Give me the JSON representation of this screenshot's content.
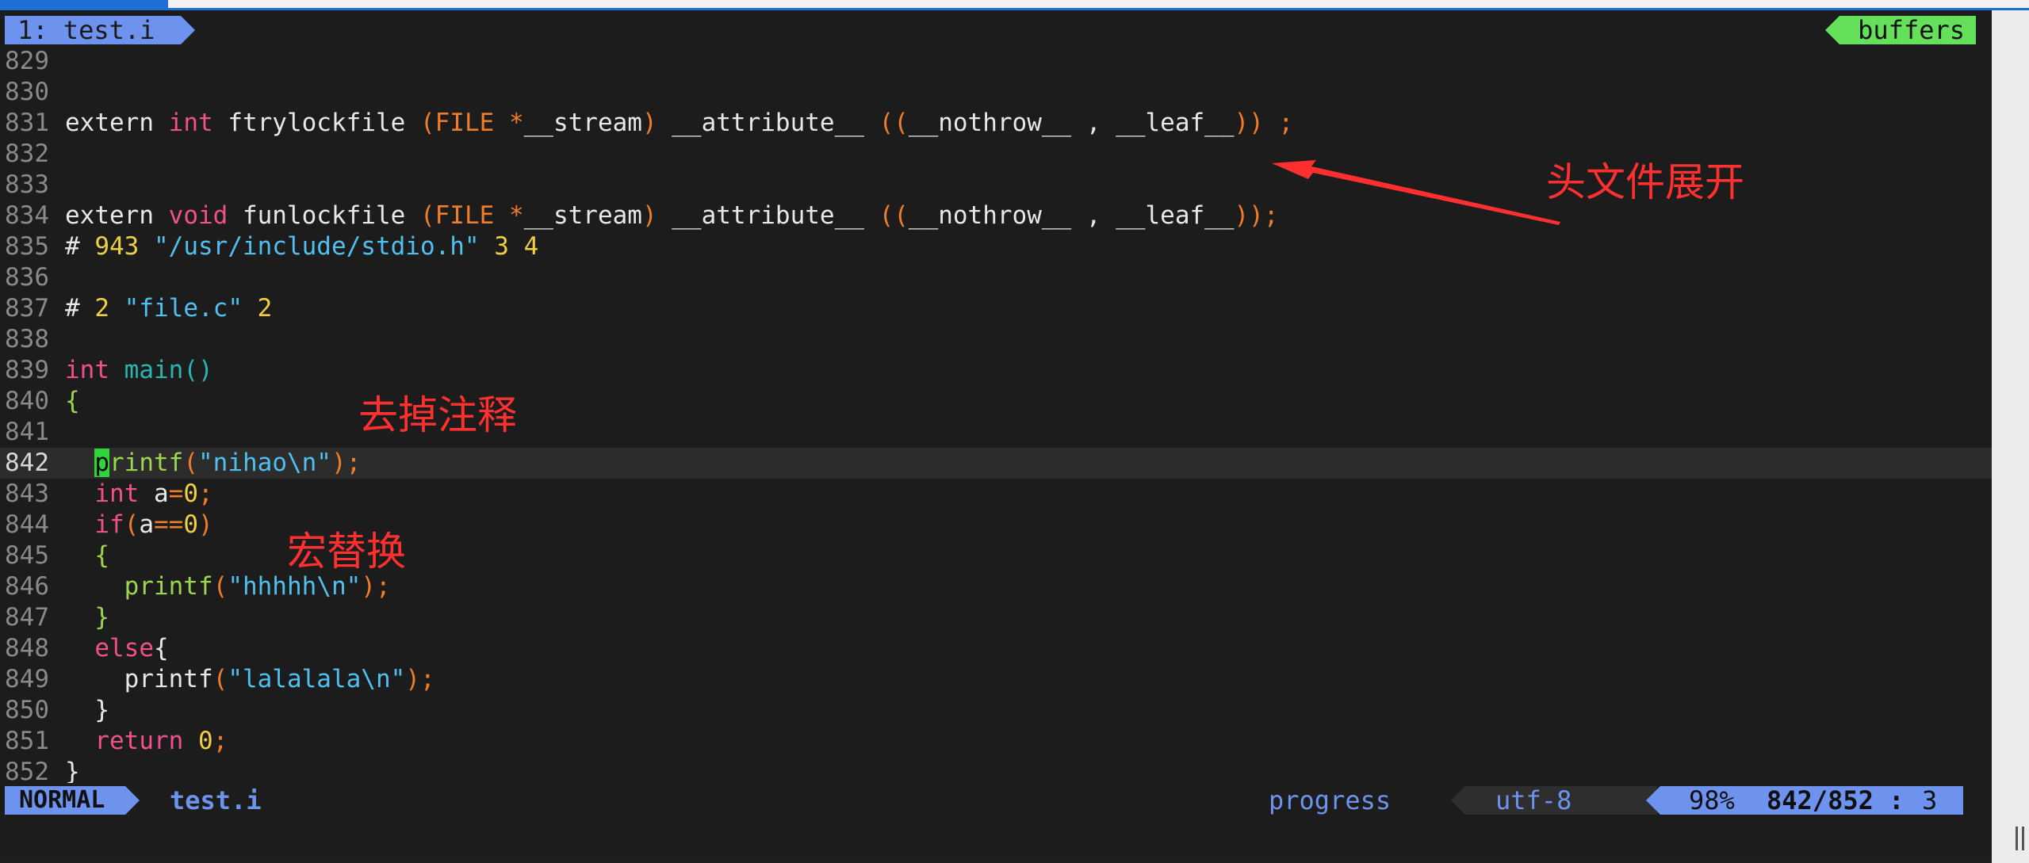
{
  "tabline": {
    "active_tab": "1: test.i",
    "right_label": "buffers"
  },
  "lines": [
    {
      "n": "829",
      "tokens": []
    },
    {
      "n": "830",
      "tokens": []
    },
    {
      "n": "831",
      "tokens": [
        {
          "t": "extern ",
          "c": ""
        },
        {
          "t": "int",
          "c": "ty"
        },
        {
          "t": " ftrylockfile ",
          "c": ""
        },
        {
          "t": "(",
          "c": "brk"
        },
        {
          "t": "FILE",
          "c": "op"
        },
        {
          "t": " ",
          "c": ""
        },
        {
          "t": "*",
          "c": "op"
        },
        {
          "t": "__stream",
          "c": ""
        },
        {
          "t": ")",
          "c": "brk"
        },
        {
          "t": " __attribute__ ",
          "c": ""
        },
        {
          "t": "((",
          "c": "brk"
        },
        {
          "t": "__nothrow__ , __leaf__",
          "c": ""
        },
        {
          "t": "))",
          "c": "brk"
        },
        {
          "t": " ;",
          "c": "op"
        }
      ]
    },
    {
      "n": "832",
      "tokens": []
    },
    {
      "n": "833",
      "tokens": []
    },
    {
      "n": "834",
      "tokens": [
        {
          "t": "extern ",
          "c": ""
        },
        {
          "t": "void",
          "c": "ty"
        },
        {
          "t": " funlockfile ",
          "c": ""
        },
        {
          "t": "(",
          "c": "brk"
        },
        {
          "t": "FILE",
          "c": "op"
        },
        {
          "t": " ",
          "c": ""
        },
        {
          "t": "*",
          "c": "op"
        },
        {
          "t": "__stream",
          "c": ""
        },
        {
          "t": ")",
          "c": "brk"
        },
        {
          "t": " __attribute__ ",
          "c": ""
        },
        {
          "t": "((",
          "c": "brk"
        },
        {
          "t": "__nothrow__ , __leaf__",
          "c": ""
        },
        {
          "t": "));",
          "c": "brk"
        }
      ]
    },
    {
      "n": "835",
      "tokens": [
        {
          "t": "# ",
          "c": ""
        },
        {
          "t": "943",
          "c": "num"
        },
        {
          "t": " ",
          "c": ""
        },
        {
          "t": "\"/usr/include/stdio.h\"",
          "c": "str"
        },
        {
          "t": " ",
          "c": ""
        },
        {
          "t": "3",
          "c": "num"
        },
        {
          "t": " ",
          "c": ""
        },
        {
          "t": "4",
          "c": "num"
        }
      ]
    },
    {
      "n": "836",
      "tokens": []
    },
    {
      "n": "837",
      "tokens": [
        {
          "t": "# ",
          "c": ""
        },
        {
          "t": "2",
          "c": "num"
        },
        {
          "t": " ",
          "c": ""
        },
        {
          "t": "\"file.c\"",
          "c": "str"
        },
        {
          "t": " ",
          "c": ""
        },
        {
          "t": "2",
          "c": "num"
        }
      ]
    },
    {
      "n": "838",
      "tokens": []
    },
    {
      "n": "839",
      "tokens": [
        {
          "t": "int",
          "c": "ty"
        },
        {
          "t": " ",
          "c": ""
        },
        {
          "t": "main()",
          "c": "fn"
        }
      ]
    },
    {
      "n": "840",
      "tokens": [
        {
          "t": "{",
          "c": "grn"
        }
      ]
    },
    {
      "n": "841",
      "tokens": []
    },
    {
      "n": "842",
      "current": true,
      "tokens": [
        {
          "t": "  ",
          "c": ""
        },
        {
          "t": "p",
          "c": "cursor"
        },
        {
          "t": "rintf",
          "c": "grn"
        },
        {
          "t": "(",
          "c": "brk"
        },
        {
          "t": "\"nihao\\n\"",
          "c": "str"
        },
        {
          "t": ");",
          "c": "brk"
        }
      ]
    },
    {
      "n": "843",
      "tokens": [
        {
          "t": "  ",
          "c": ""
        },
        {
          "t": "int",
          "c": "ty"
        },
        {
          "t": " a",
          "c": ""
        },
        {
          "t": "=",
          "c": "op"
        },
        {
          "t": "0",
          "c": "num"
        },
        {
          "t": ";",
          "c": "op"
        }
      ]
    },
    {
      "n": "844",
      "tokens": [
        {
          "t": "  ",
          "c": ""
        },
        {
          "t": "if",
          "c": "kw"
        },
        {
          "t": "(",
          "c": "brk"
        },
        {
          "t": "a",
          "c": ""
        },
        {
          "t": "==",
          "c": "op"
        },
        {
          "t": "0",
          "c": "num"
        },
        {
          "t": ")",
          "c": "brk"
        }
      ]
    },
    {
      "n": "845",
      "tokens": [
        {
          "t": "  ",
          "c": ""
        },
        {
          "t": "{",
          "c": "grn"
        }
      ]
    },
    {
      "n": "846",
      "tokens": [
        {
          "t": "    ",
          "c": ""
        },
        {
          "t": "printf",
          "c": "grn"
        },
        {
          "t": "(",
          "c": "brk"
        },
        {
          "t": "\"hhhhh\\n\"",
          "c": "str"
        },
        {
          "t": ");",
          "c": "brk"
        }
      ]
    },
    {
      "n": "847",
      "tokens": [
        {
          "t": "  ",
          "c": ""
        },
        {
          "t": "}",
          "c": "grn"
        }
      ]
    },
    {
      "n": "848",
      "tokens": [
        {
          "t": "  ",
          "c": ""
        },
        {
          "t": "else",
          "c": "kw"
        },
        {
          "t": "{",
          "c": ""
        }
      ]
    },
    {
      "n": "849",
      "tokens": [
        {
          "t": "    ",
          "c": ""
        },
        {
          "t": "printf",
          "c": ""
        },
        {
          "t": "(",
          "c": "brk"
        },
        {
          "t": "\"lalalala\\n\"",
          "c": "str"
        },
        {
          "t": ");",
          "c": "brk"
        }
      ]
    },
    {
      "n": "850",
      "tokens": [
        {
          "t": "  ",
          "c": ""
        },
        {
          "t": "}",
          "c": ""
        }
      ]
    },
    {
      "n": "851",
      "tokens": [
        {
          "t": "  ",
          "c": ""
        },
        {
          "t": "return",
          "c": "kw"
        },
        {
          "t": " ",
          "c": ""
        },
        {
          "t": "0",
          "c": "num"
        },
        {
          "t": ";",
          "c": "op"
        }
      ]
    },
    {
      "n": "852",
      "tokens": [
        {
          "t": "}",
          "c": ""
        }
      ]
    }
  ],
  "annotations": {
    "header_expand": "头文件展开",
    "remove_comments": "去掉注释",
    "macro_replace": "宏替换"
  },
  "statusline": {
    "mode": "NORMAL",
    "filename": "test.i",
    "progress": "progress",
    "encoding": "utf-8",
    "percent": "98%",
    "position": "842/852 :",
    "column": "3"
  },
  "colors": {
    "accent_blue": "#6e93ee",
    "accent_green": "#64e05a",
    "annotation_red": "#ff3030"
  }
}
